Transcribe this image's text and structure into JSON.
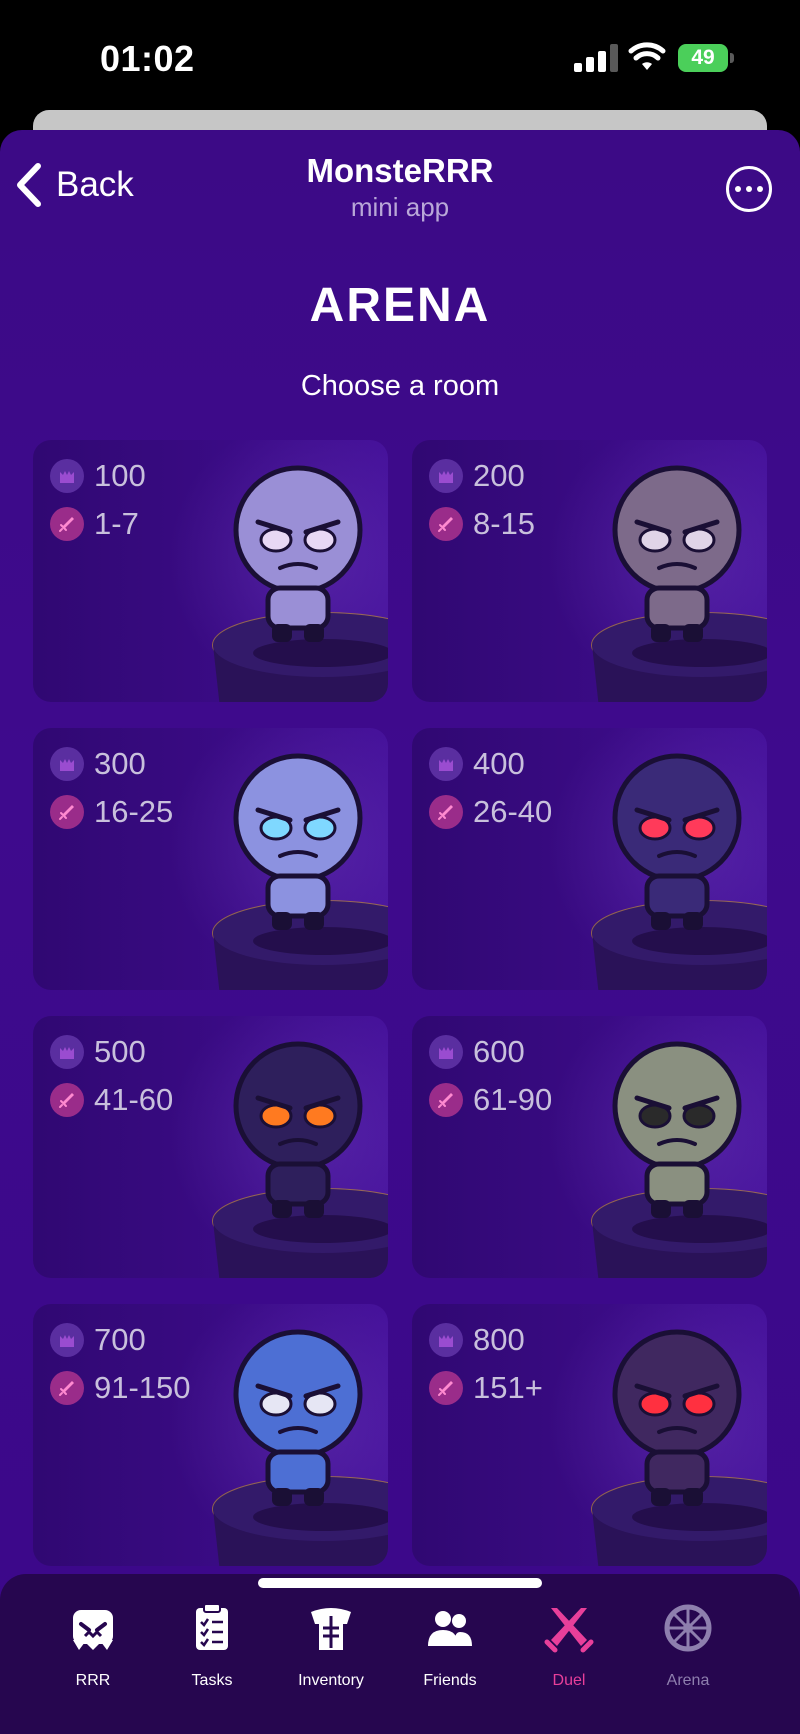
{
  "status_bar": {
    "time": "01:02",
    "battery": "49"
  },
  "header": {
    "back_label": "Back",
    "title": "MonsteRRR",
    "subtitle": "mini app"
  },
  "main": {
    "title": "ARENA",
    "subtitle": "Choose a room",
    "rooms": [
      {
        "prize": "100",
        "levels": "1-7",
        "monster_color": "#9a8fd6",
        "eye_color": "#e8d8f4"
      },
      {
        "prize": "200",
        "levels": "8-15",
        "monster_color": "#7d6a8a",
        "eye_color": "#e0d4e8"
      },
      {
        "prize": "300",
        "levels": "16-25",
        "monster_color": "#8c92e0",
        "eye_color": "#7fd8ff"
      },
      {
        "prize": "400",
        "levels": "26-40",
        "monster_color": "#3a2a78",
        "eye_color": "#ff3a5a"
      },
      {
        "prize": "500",
        "levels": "41-60",
        "monster_color": "#2e1f5c",
        "eye_color": "#ff7a20"
      },
      {
        "prize": "600",
        "levels": "61-90",
        "monster_color": "#8a9080",
        "eye_color": "#2a2a2a"
      },
      {
        "prize": "700",
        "levels": "91-150",
        "monster_color": "#4d6fd4",
        "eye_color": "#e6e6f4"
      },
      {
        "prize": "800",
        "levels": "151+",
        "monster_color": "#402860",
        "eye_color": "#ff3040"
      }
    ]
  },
  "tabbar": {
    "items": [
      {
        "label": "RRR",
        "icon": "monster-icon"
      },
      {
        "label": "Tasks",
        "icon": "clipboard-icon"
      },
      {
        "label": "Inventory",
        "icon": "armor-icon"
      },
      {
        "label": "Friends",
        "icon": "friends-icon"
      },
      {
        "label": "Duel",
        "icon": "crossed-swords-icon",
        "active": true
      },
      {
        "label": "Arena",
        "icon": "wheel-icon"
      }
    ]
  },
  "colors": {
    "background": "#3c0a86",
    "accent": "#e83f9a",
    "tabbar": "#26064f"
  }
}
